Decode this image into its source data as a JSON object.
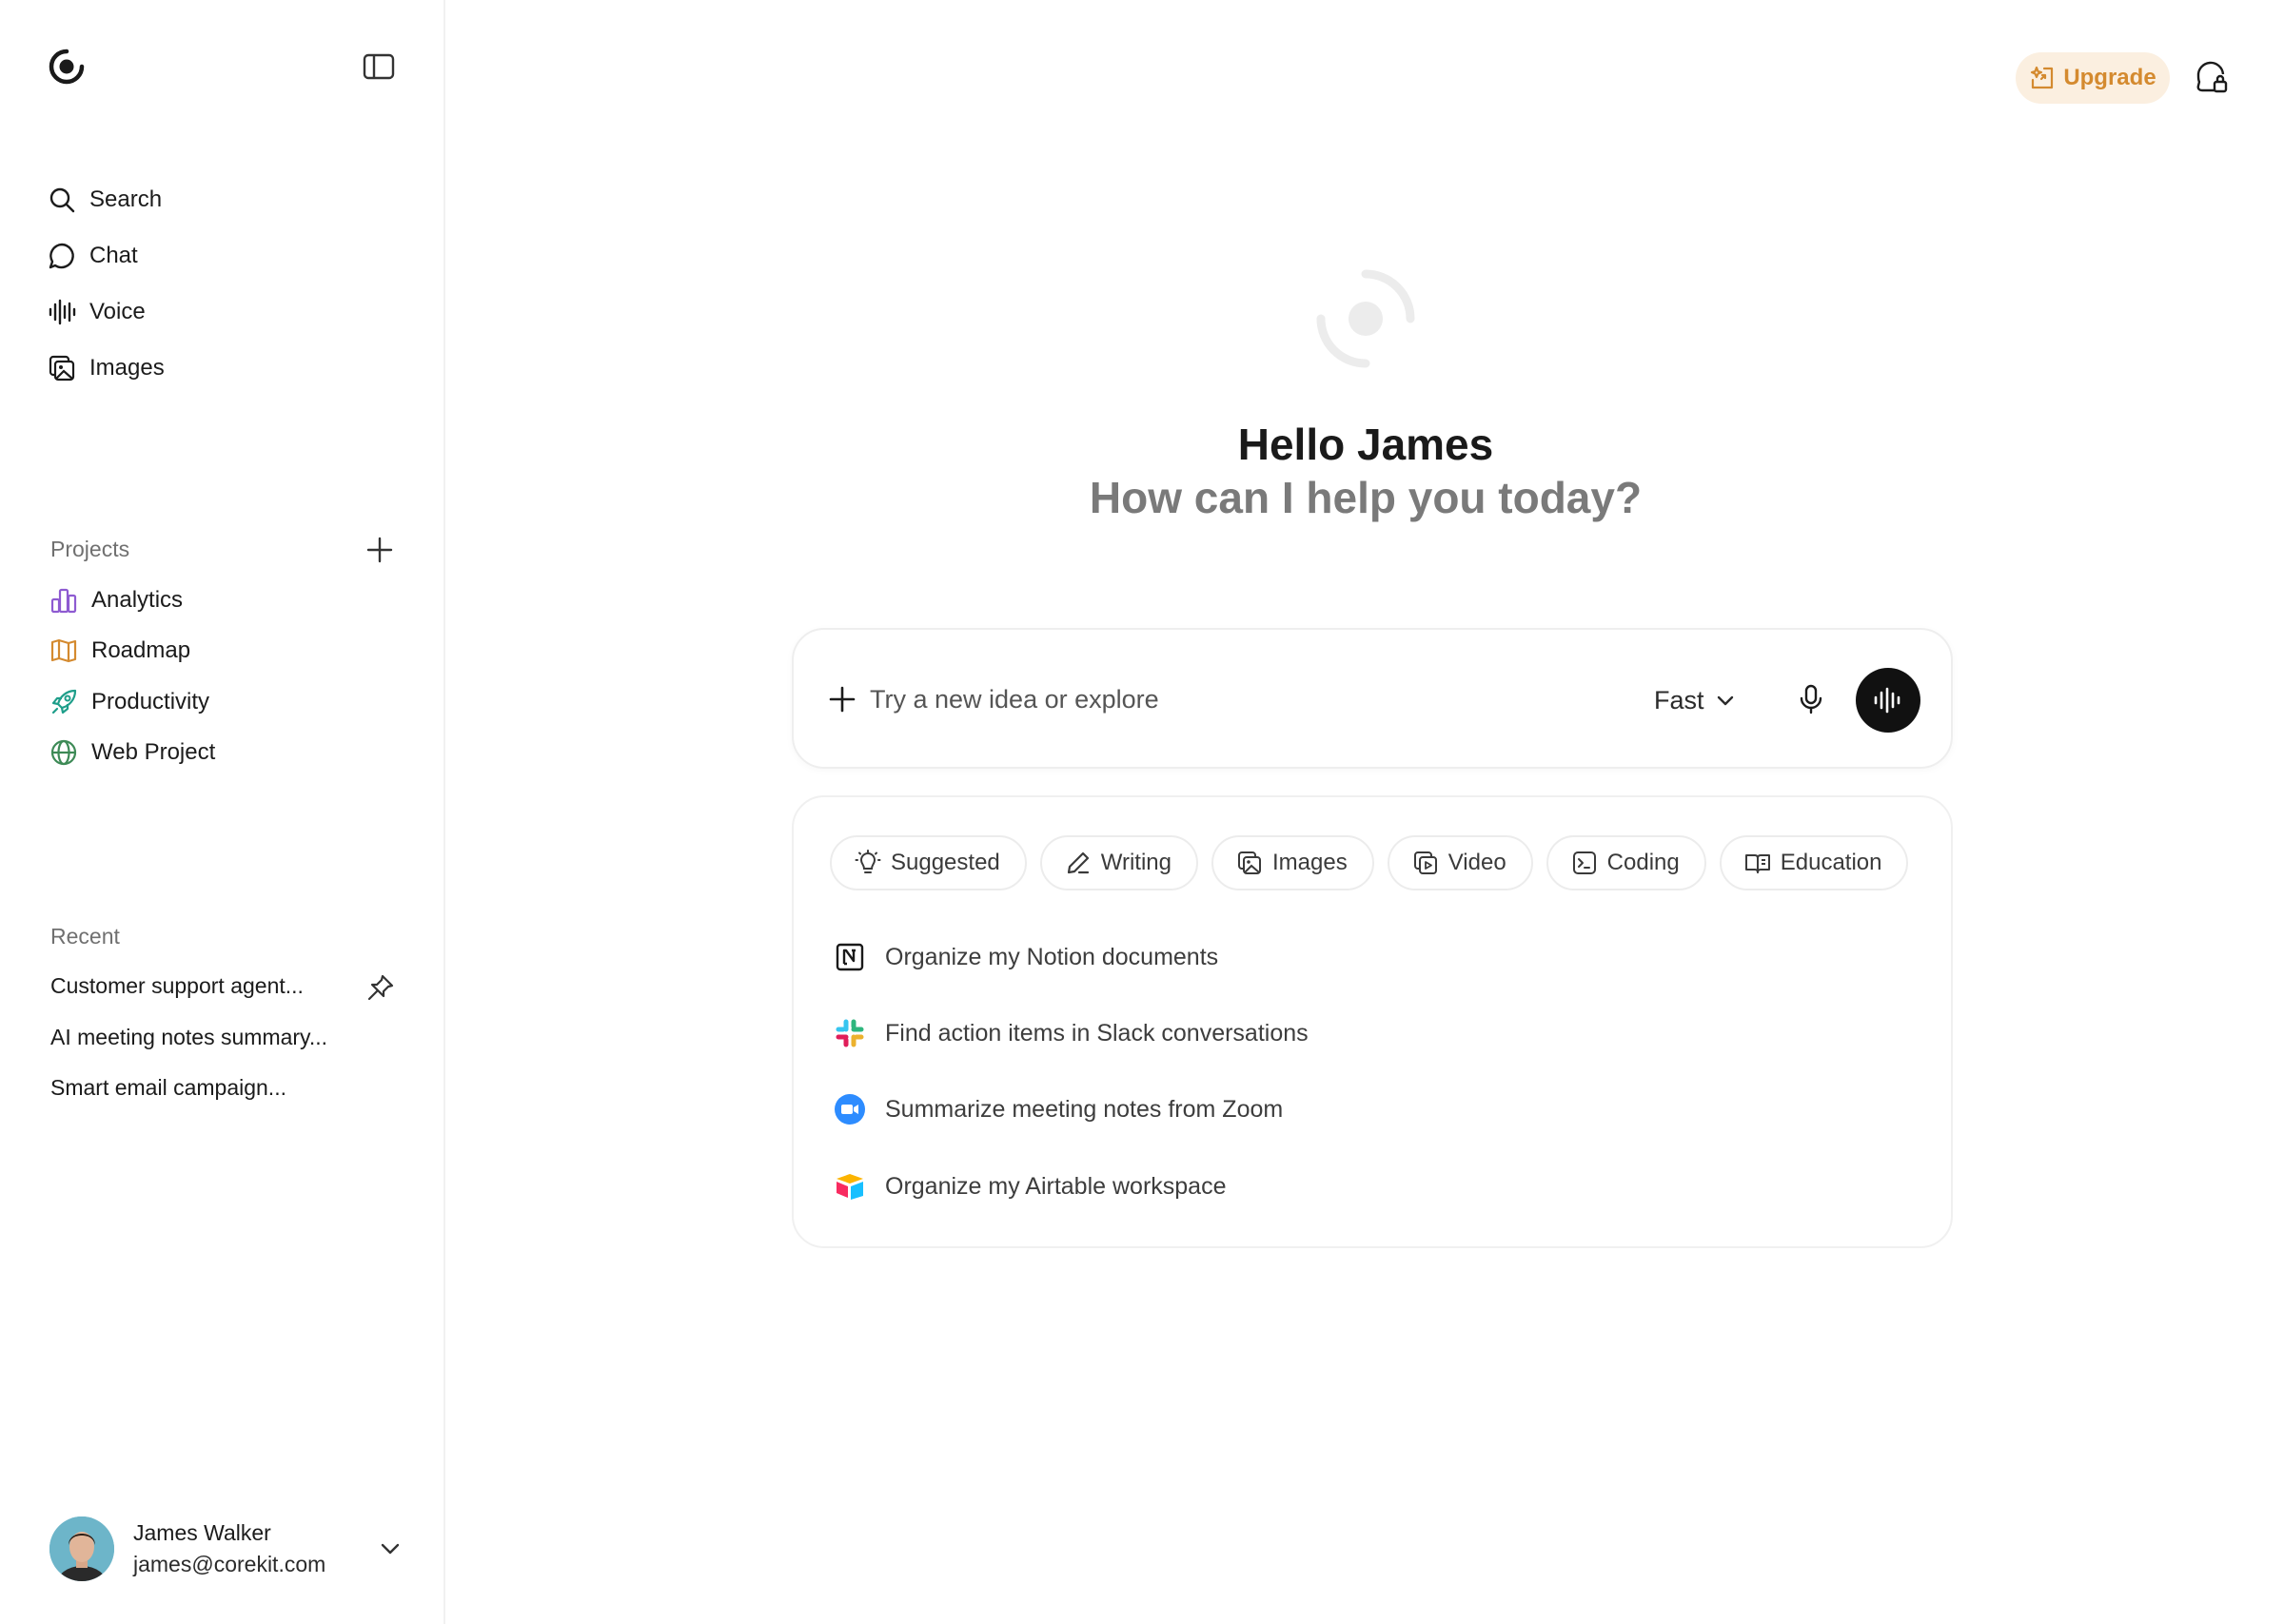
{
  "sidebar": {
    "nav": [
      {
        "label": "Search",
        "icon": "search-icon"
      },
      {
        "label": "Chat",
        "icon": "chat-bubble-icon"
      },
      {
        "label": "Voice",
        "icon": "waveform-icon"
      },
      {
        "label": "Images",
        "icon": "images-icon"
      }
    ],
    "projects_label": "Projects",
    "projects": [
      {
        "label": "Analytics",
        "icon": "bar-chart-icon",
        "color": "#8e5bd1"
      },
      {
        "label": "Roadmap",
        "icon": "map-icon",
        "color": "#d48a2f"
      },
      {
        "label": "Productivity",
        "icon": "rocket-icon",
        "color": "#1e9e8a"
      },
      {
        "label": "Web Project",
        "icon": "globe-icon",
        "color": "#3d8a56"
      }
    ],
    "recent_label": "Recent",
    "recent": [
      {
        "label": "Customer support agent..."
      },
      {
        "label": "AI meeting notes summary..."
      },
      {
        "label": "Smart email campaign..."
      }
    ],
    "user": {
      "name": "James Walker",
      "email": "james@corekit.com"
    }
  },
  "header": {
    "upgrade_label": "Upgrade",
    "accent_color": "#d48a2f"
  },
  "hero": {
    "greeting": "Hello James",
    "subtitle": "How can I help you today?"
  },
  "composer": {
    "placeholder": "Try a new idea or explore",
    "model": "Fast"
  },
  "categories": [
    {
      "label": "Suggested",
      "icon": "lightbulb-icon"
    },
    {
      "label": "Writing",
      "icon": "pen-icon"
    },
    {
      "label": "Images",
      "icon": "images-icon"
    },
    {
      "label": "Video",
      "icon": "video-icon"
    },
    {
      "label": "Coding",
      "icon": "terminal-icon"
    },
    {
      "label": "Education",
      "icon": "book-icon"
    }
  ],
  "suggestions": [
    {
      "label": "Organize my Notion documents",
      "icon": "notion-icon"
    },
    {
      "label": "Find action items in Slack conversations",
      "icon": "slack-icon"
    },
    {
      "label": "Summarize meeting notes from Zoom",
      "icon": "zoom-icon"
    },
    {
      "label": "Organize my Airtable workspace",
      "icon": "airtable-icon"
    }
  ]
}
